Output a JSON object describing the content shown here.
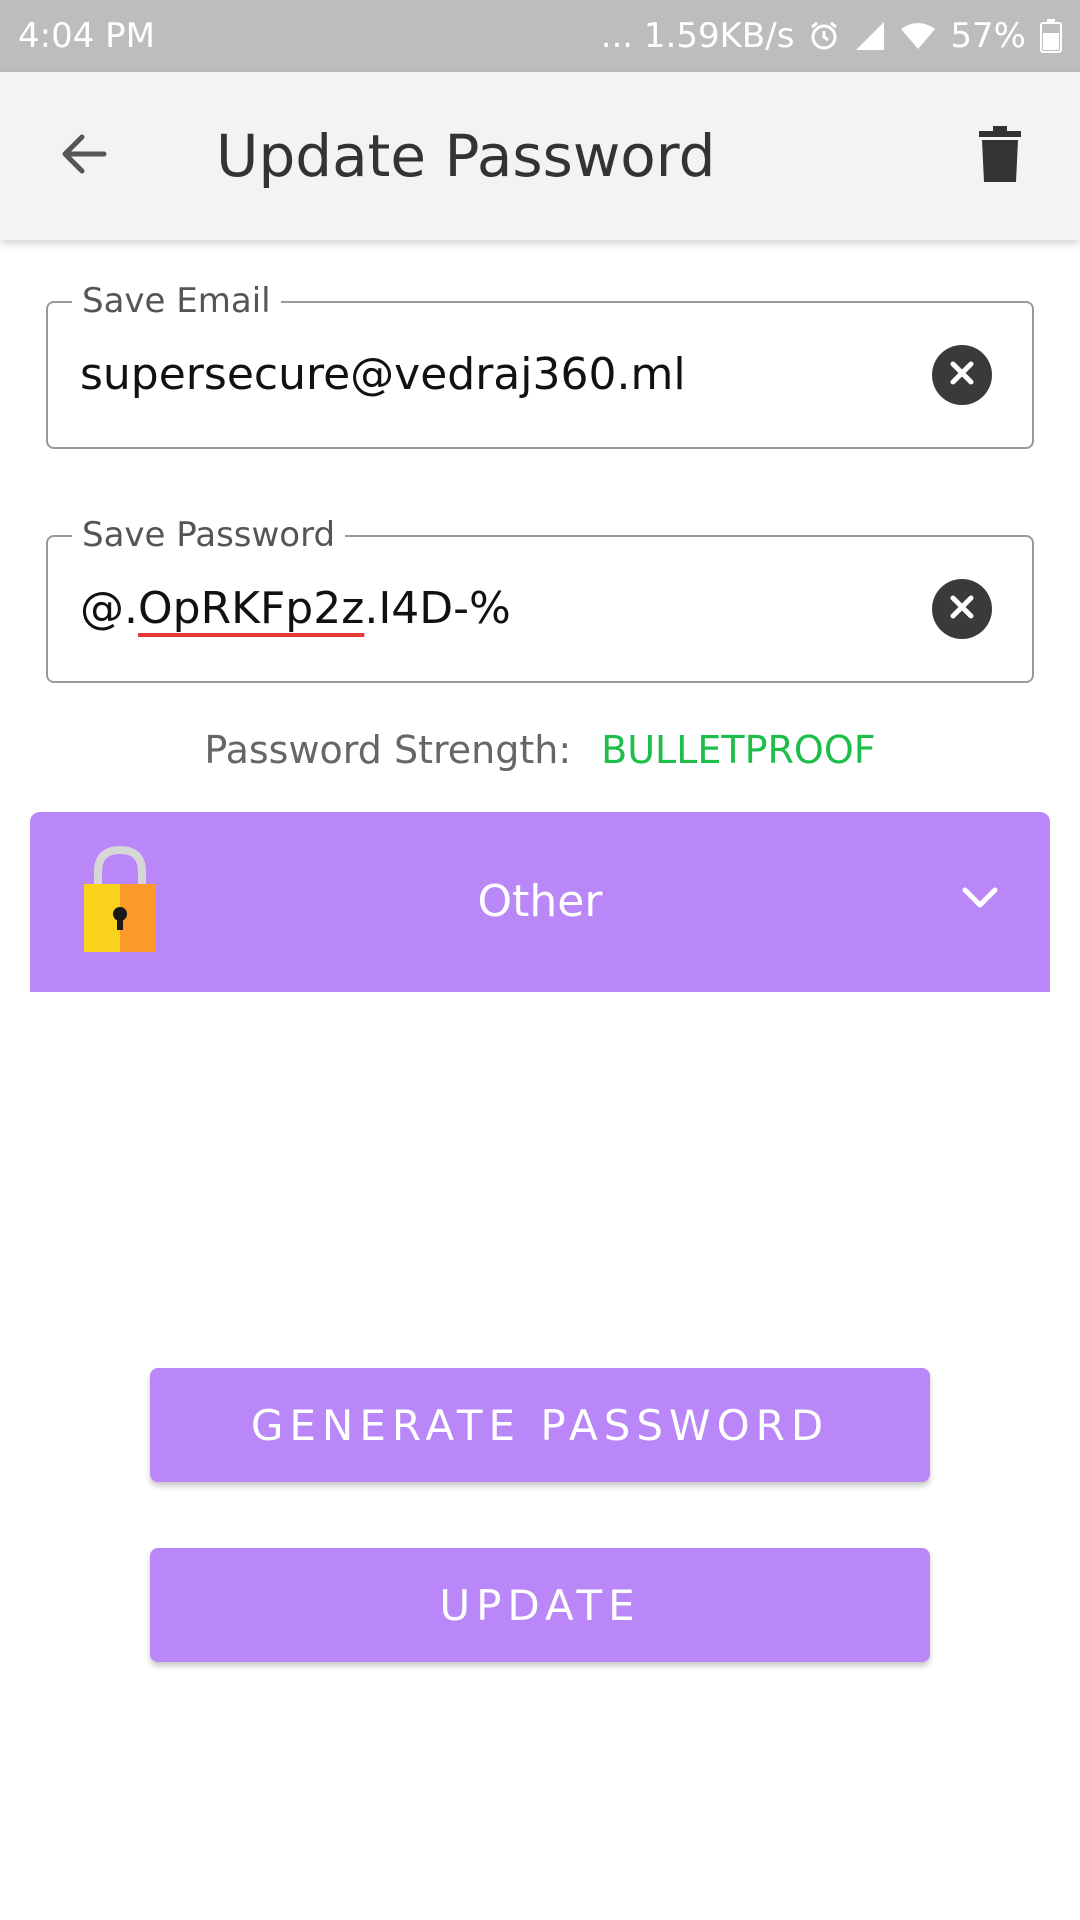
{
  "status_bar": {
    "time": "4:04 PM",
    "network_speed": "... 1.59KB/s",
    "battery": "57%",
    "icons": [
      "alarm-icon",
      "cell-signal-icon",
      "wifi-icon",
      "battery-icon"
    ]
  },
  "app_bar": {
    "title": "Update Password",
    "back_icon": "arrow-left-icon",
    "delete_icon": "trash-icon"
  },
  "email_field": {
    "label": "Save Email",
    "value": "supersecure@vedraj360.ml",
    "clear_icon": "close-circle-icon"
  },
  "password_field": {
    "label": "Save Password",
    "value_prefix": "@.",
    "value_misspelled": "OpRKFp2z",
    "value_suffix": ".I4D-%",
    "clear_icon": "close-circle-icon"
  },
  "strength": {
    "label": "Password Strength:",
    "value": "BULLETPROOF",
    "value_color": "#1dbf4a"
  },
  "category": {
    "label": "Other",
    "icon": "padlock-icon",
    "expand_icon": "chevron-down-icon",
    "color": "#b987f7"
  },
  "buttons": {
    "generate_label": "GENERATE PASSWORD",
    "update_label": "UPDATE",
    "color": "#b987f7"
  }
}
